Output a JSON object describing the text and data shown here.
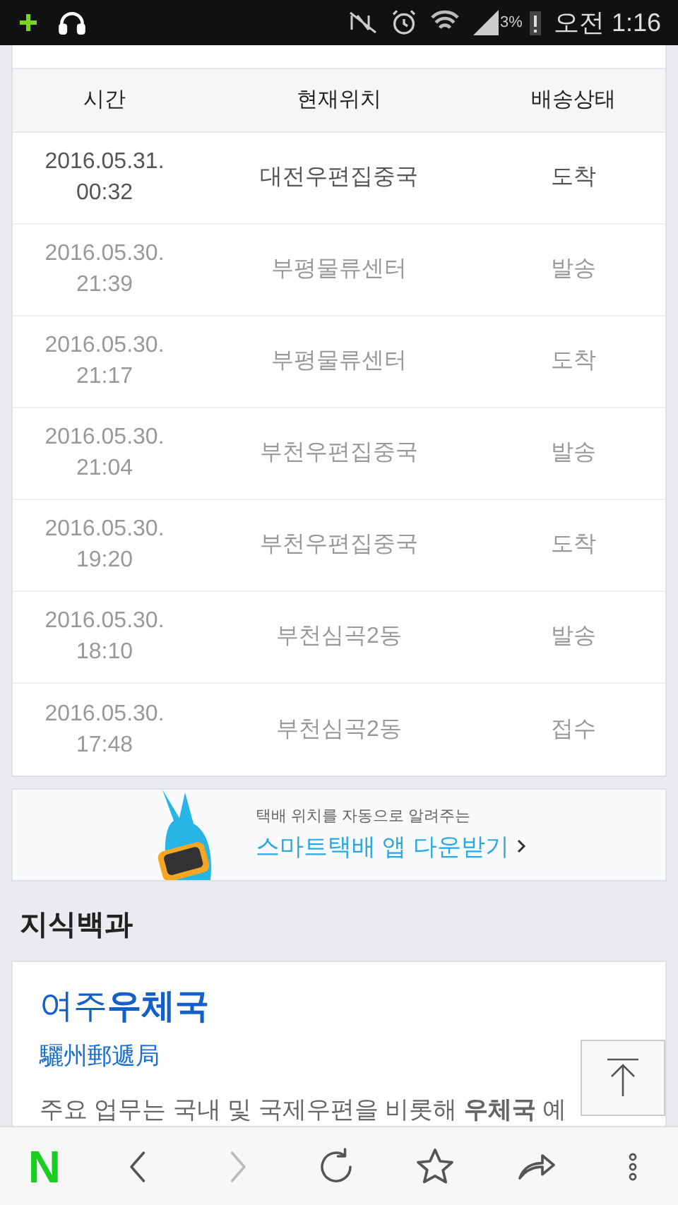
{
  "status_bar": {
    "battery": "3%",
    "time": "오전 1:16"
  },
  "tracking_table": {
    "columns": [
      "시간",
      "현재위치",
      "배송상태"
    ],
    "rows": [
      {
        "time": "2016.05.31.\n00:32",
        "location": "대전우편집중국",
        "status": "도착",
        "latest": true
      },
      {
        "time": "2016.05.30.\n21:39",
        "location": "부평물류센터",
        "status": "발송",
        "latest": false
      },
      {
        "time": "2016.05.30.\n21:17",
        "location": "부평물류센터",
        "status": "도착",
        "latest": false
      },
      {
        "time": "2016.05.30.\n21:04",
        "location": "부천우편집중국",
        "status": "발송",
        "latest": false
      },
      {
        "time": "2016.05.30.\n19:20",
        "location": "부천우편집중국",
        "status": "도착",
        "latest": false
      },
      {
        "time": "2016.05.30.\n18:10",
        "location": "부천심곡2동",
        "status": "발송",
        "latest": false
      },
      {
        "time": "2016.05.30.\n17:48",
        "location": "부천심곡2동",
        "status": "접수",
        "latest": false
      }
    ]
  },
  "banner": {
    "caption": "택배 위치를 자동으로 알려주는",
    "link": "스마트택배 앱 다운받기"
  },
  "encyclopedia": {
    "heading": "지식백과",
    "title": "여주**우체국**",
    "subtitle": "驪州郵遞局",
    "text": "주요 업무는 국내 및 국제우편을 비롯해 **우체국** 예"
  },
  "toolbar": {
    "logo": "N",
    "forward_disabled": true
  }
}
